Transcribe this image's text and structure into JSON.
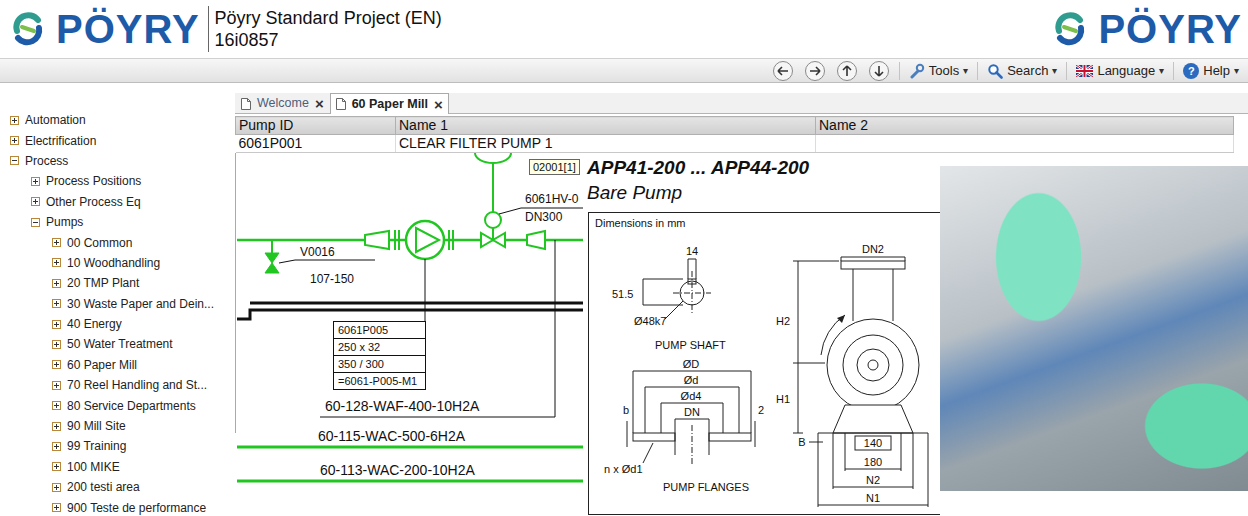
{
  "header": {
    "logo": "PÖYRY",
    "project_title": "Pöyry Standard Project (EN)",
    "project_code": "16i0857",
    "logo_right": "PÖYRY"
  },
  "toolbar": {
    "menus": [
      {
        "label": "Tools",
        "caret": "▾"
      },
      {
        "label": "Search",
        "caret": "▾"
      },
      {
        "label": "Language",
        "caret": "▾"
      },
      {
        "label": "Help",
        "caret": "▾",
        "icon": "?"
      }
    ]
  },
  "sidebar": {
    "items": [
      {
        "label": "Automation",
        "expanded": false
      },
      {
        "label": "Electrification",
        "expanded": false
      },
      {
        "label": "Process",
        "expanded": true,
        "children": [
          {
            "label": "Process Positions",
            "expanded": false
          },
          {
            "label": "Other Process Eq",
            "expanded": false
          },
          {
            "label": "Pumps",
            "expanded": true,
            "children": [
              {
                "label": "00 Common",
                "expanded": false
              },
              {
                "label": "10 Woodhandling",
                "expanded": false
              },
              {
                "label": "20 TMP Plant",
                "expanded": false
              },
              {
                "label": "30 Waste Paper and Dein...",
                "expanded": false
              },
              {
                "label": "40 Energy",
                "expanded": false
              },
              {
                "label": "50 Water Treatment",
                "expanded": false
              },
              {
                "label": "60 Paper Mill",
                "expanded": false
              },
              {
                "label": "70 Reel Handling and St...",
                "expanded": false
              },
              {
                "label": "80 Service Departments",
                "expanded": false
              },
              {
                "label": "90 Mill Site",
                "expanded": false
              },
              {
                "label": "99 Training",
                "expanded": false
              },
              {
                "label": "100 MIKE",
                "expanded": false
              },
              {
                "label": "200 testi area",
                "expanded": false
              },
              {
                "label": "900 Teste de performance",
                "expanded": false
              }
            ]
          }
        ]
      }
    ]
  },
  "tabs": [
    {
      "label": "Welcome",
      "selected": false,
      "close": "×"
    },
    {
      "label": "60 Paper Mill",
      "selected": true,
      "close": "×"
    }
  ],
  "table": {
    "columns": [
      "Pump ID",
      "Name 1",
      "Name 2"
    ],
    "rows": [
      [
        "6061P001",
        "CLEAR FILTER PUMP 1",
        ""
      ]
    ]
  },
  "diagram": {
    "valve_tag": "6061HV-0",
    "valve_size": "DN300",
    "hand_valve_tag": "V0016",
    "hand_valve_line": "107-150",
    "pump_box": [
      "6061P005",
      "250 x 32",
      "350 / 300",
      "=6061-P005-M1"
    ],
    "lines": [
      "60-128-WAF-400-10H2A",
      "60-115-WAC-500-6H2A",
      "60-113-WAC-200-10H2A"
    ],
    "tooltip": "02001[1]"
  },
  "datasheet": {
    "title": "APP41-200 ... APP44-200",
    "subtitle": "Bare Pump",
    "caption": "Dimensions in mm",
    "labels": [
      "14",
      "51.5",
      "Ø48k7",
      "PUMP SHAFT",
      "ØD",
      "Ød",
      "Ød4",
      "DN",
      "b",
      "2",
      "n x Ød1",
      "PUMP FLANGES",
      "DN2",
      "H2",
      "H1",
      "B",
      "140",
      "180",
      "N2",
      "N1"
    ]
  }
}
